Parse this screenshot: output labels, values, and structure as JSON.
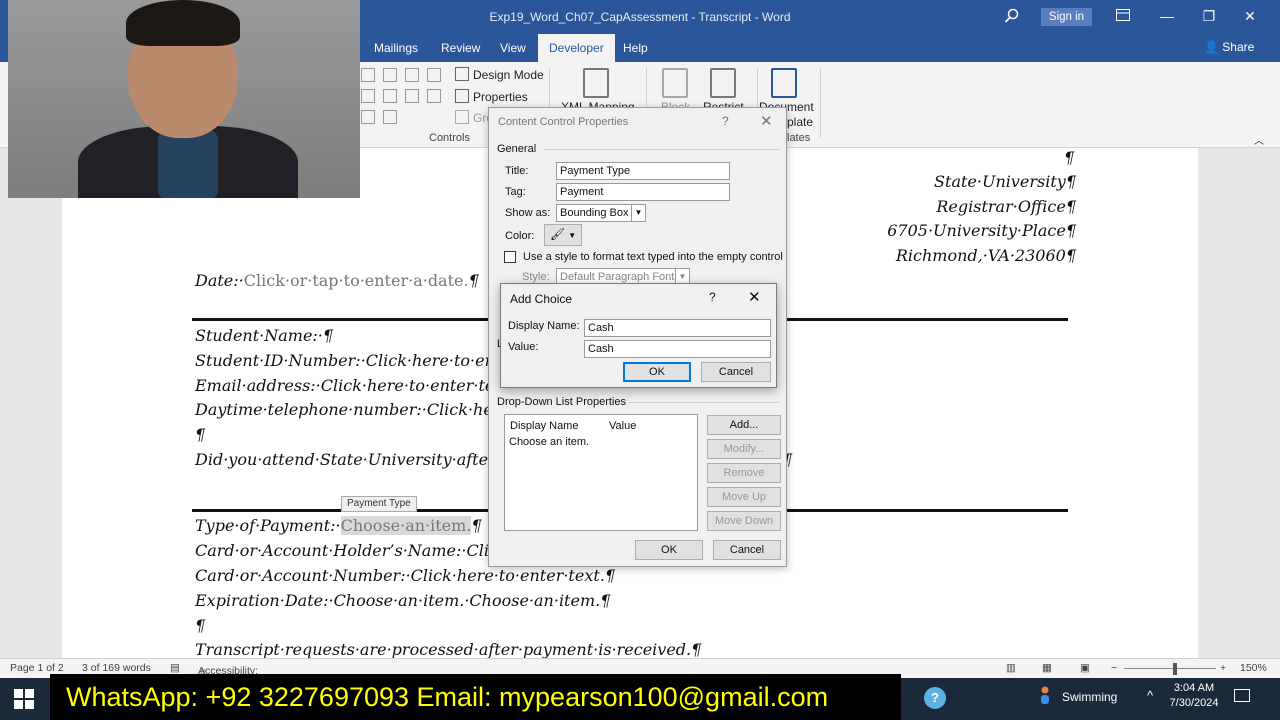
{
  "window": {
    "title": "Exp19_Word_Ch07_CapAssessment - Transcript - Word",
    "signin_label": "Sign in",
    "minimize": "—",
    "restore": "❐",
    "close": "✕"
  },
  "ribbon_tabs": [
    "Mailings",
    "Review",
    "View",
    "Developer",
    "Help"
  ],
  "active_tab": "Developer",
  "share_label": "Share",
  "ribbon": {
    "design_mode": "Design Mode",
    "properties": "Properties",
    "group_stub": "Gro",
    "controls_label": "Controls",
    "xml_mapping": "XML Mapping",
    "block": "Block",
    "restrict": "Restrict",
    "document": "Document",
    "template": "plate",
    "templates_label": "lates"
  },
  "document": {
    "pilcrow_top": "¶",
    "address": [
      "State·University¶",
      "Registrar·Office¶",
      "6705·University·Place¶",
      "Richmond,·VA·23060¶"
    ],
    "date_label": "Date:·",
    "date_placeholder": "Click·or·tap·to·enter·a·date.",
    "date_end": "¶",
    "student_name": "Student·Name:·¶",
    "student_id": "Student·ID·Number:·Click·here·to·en",
    "email": "Email·address:·Click·here·to·enter·te",
    "phone": "Daytime·telephone·number:·Click·he",
    "pilcrow_mid": "¶",
    "attend": "Did·you·attend·State·University·afte",
    "attend_end": "¶",
    "cc_tag": "Payment Type",
    "payment_label": "Type·of·Payment:·",
    "payment_field": "Choose·an·item.",
    "payment_end": "¶",
    "card_holder": "Card·or·Account·Holder’s·Name:·Clic",
    "card_number": "Card·or·Account·Number:·Click·here·to·enter·text.¶",
    "expiration": "Expiration·Date:·Choose·an·item.·Choose·an·item.¶",
    "pilcrow_low": "¶",
    "transcript_note": "Transcript·requests·are·processed·after·payment·is·received.¶"
  },
  "ccp_dialog": {
    "title": "Content Control Properties",
    "help": "?",
    "close": "✕",
    "general": "General",
    "title_label": "Title:",
    "title_value": "Payment Type",
    "tag_label": "Tag:",
    "tag_value": "Payment",
    "show_as_label": "Show as:",
    "show_as_value": "Bounding Box",
    "color_label": "Color:",
    "use_style": "Use a style to format text typed into the empty control",
    "style_label": "Style:",
    "style_value": "Default Paragraph Font",
    "locking_stub": "L",
    "dropdown_props": "Drop-Down List Properties",
    "col_display": "Display Name",
    "col_value": "Value",
    "list_item": "Choose an item.",
    "btn_add": "Add...",
    "btn_modify": "Modify...",
    "btn_remove": "Remove",
    "btn_move_up": "Move Up",
    "btn_move_down": "Move Down",
    "btn_ok": "OK",
    "btn_cancel": "Cancel"
  },
  "add_choice": {
    "title": "Add Choice",
    "help": "?",
    "close": "✕",
    "display_name_label": "Display Name:",
    "display_name_value": "Cash",
    "value_label": "Value:",
    "value_value": "Cash",
    "btn_ok": "OK",
    "btn_cancel": "Cancel"
  },
  "status": {
    "page": "Page 1 of 2",
    "words": "3 of 169 words",
    "accessibility": "Accessibility: Investigate",
    "zoom": "150%",
    "minus": "−",
    "plus": "+"
  },
  "banner": "WhatsApp: +92 3227697093  Email: mypearson100@gmail.com",
  "taskbar": {
    "weather": "Swimming",
    "chevron": "^",
    "time": "3:04 AM",
    "date": "7/30/2024",
    "help_glyph": "?"
  },
  "colors": {
    "word_blue": "#2b579a",
    "banner_text": "#ffff00",
    "default_button_border": "#0078d7"
  }
}
